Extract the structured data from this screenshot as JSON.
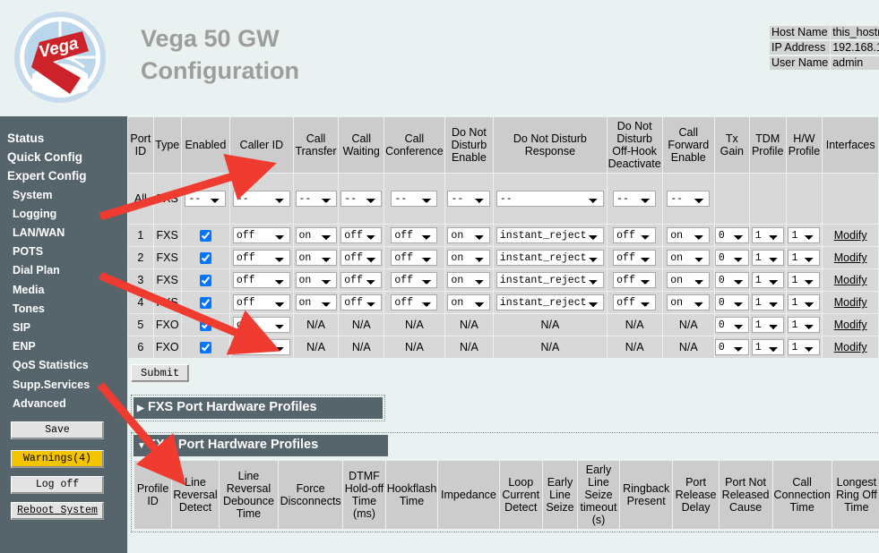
{
  "header": {
    "title_line1": "Vega 50 GW",
    "title_line2": "Configuration",
    "logo_text": "Vega",
    "info": [
      {
        "key": "Host Name",
        "value": "this_hostn"
      },
      {
        "key": "IP Address",
        "value": "192.168.1"
      },
      {
        "key": "User Name",
        "value": "admin"
      }
    ]
  },
  "sidebar": {
    "items": [
      {
        "label": "Status",
        "sub": false
      },
      {
        "label": "Quick Config",
        "sub": false
      },
      {
        "label": "Expert Config",
        "sub": false
      },
      {
        "label": "System",
        "sub": true
      },
      {
        "label": "Logging",
        "sub": true
      },
      {
        "label": "LAN/WAN",
        "sub": true
      },
      {
        "label": "POTS",
        "sub": true
      },
      {
        "label": "Dial Plan",
        "sub": true
      },
      {
        "label": "Media",
        "sub": true
      },
      {
        "label": "Tones",
        "sub": true
      },
      {
        "label": "SIP",
        "sub": true
      },
      {
        "label": "ENP",
        "sub": true
      },
      {
        "label": "QoS Statistics",
        "sub": true
      },
      {
        "label": "Supp.Services",
        "sub": true
      },
      {
        "label": "Advanced",
        "sub": true
      }
    ],
    "save_label": "Save",
    "warnings_label": "Warnings(4)",
    "logoff_label": "Log off",
    "reboot_label": "Reboot System"
  },
  "colors": {
    "sidebar_bg": "#56646b",
    "page_bg": "#eaf1f1",
    "header_cell": "#cccccc",
    "body_cell": "#d8d8d8",
    "warning": "#f5c400",
    "arrow": "#ef3b30",
    "logo_red": "#cc2229",
    "title_grey": "#9d9d9d"
  },
  "ports_table": {
    "columns": [
      "Port ID",
      "Type",
      "Enabled",
      "Caller ID",
      "Call Transfer",
      "Call Waiting",
      "Call Conference",
      "Do Not Disturb Enable",
      "Do Not Disturb Response",
      "Do Not Disturb Off-Hook Deactivate",
      "Call Forward Enable",
      "Tx Gain",
      "TDM Profile",
      "H/W Profile",
      "Interfaces"
    ],
    "all_row": {
      "port_id": "All",
      "type": "FXS",
      "enabled": "--",
      "caller_id": "--",
      "call_transfer": "--",
      "call_waiting": "--",
      "call_conference": "--",
      "dnd_enable": "--",
      "dnd_response": "--",
      "dnd_offhook": "--",
      "call_forward": "--",
      "tx_gain": "",
      "tdm_profile": "",
      "hw_profile": "",
      "interfaces": ""
    },
    "rows": [
      {
        "port_id": "1",
        "type": "FXS",
        "enabled": true,
        "caller_id": "off",
        "call_transfer": "on",
        "call_waiting": "off",
        "call_conference": "off",
        "dnd_enable": "on",
        "dnd_response": "instant_reject",
        "dnd_offhook": "off",
        "call_forward": "on",
        "tx_gain": "0",
        "tdm_profile": "1",
        "hw_profile": "1",
        "interfaces": "Modify"
      },
      {
        "port_id": "2",
        "type": "FXS",
        "enabled": true,
        "caller_id": "off",
        "call_transfer": "on",
        "call_waiting": "off",
        "call_conference": "off",
        "dnd_enable": "on",
        "dnd_response": "instant_reject",
        "dnd_offhook": "off",
        "call_forward": "on",
        "tx_gain": "0",
        "tdm_profile": "1",
        "hw_profile": "1",
        "interfaces": "Modify"
      },
      {
        "port_id": "3",
        "type": "FXS",
        "enabled": true,
        "caller_id": "off",
        "call_transfer": "on",
        "call_waiting": "off",
        "call_conference": "off",
        "dnd_enable": "on",
        "dnd_response": "instant_reject",
        "dnd_offhook": "off",
        "call_forward": "on",
        "tx_gain": "0",
        "tdm_profile": "1",
        "hw_profile": "1",
        "interfaces": "Modify"
      },
      {
        "port_id": "4",
        "type": "FXS",
        "enabled": true,
        "caller_id": "off",
        "call_transfer": "on",
        "call_waiting": "off",
        "call_conference": "off",
        "dnd_enable": "on",
        "dnd_response": "instant_reject",
        "dnd_offhook": "off",
        "call_forward": "on",
        "tx_gain": "0",
        "tdm_profile": "1",
        "hw_profile": "1",
        "interfaces": "Modify"
      },
      {
        "port_id": "5",
        "type": "FXO",
        "enabled": true,
        "caller_id": "on",
        "call_transfer": "N/A",
        "call_waiting": "N/A",
        "call_conference": "N/A",
        "dnd_enable": "N/A",
        "dnd_response": "N/A",
        "dnd_offhook": "N/A",
        "call_forward": "N/A",
        "tx_gain": "0",
        "tdm_profile": "1",
        "hw_profile": "1",
        "interfaces": "Modify"
      },
      {
        "port_id": "6",
        "type": "FXO",
        "enabled": true,
        "caller_id": "on",
        "call_transfer": "N/A",
        "call_waiting": "N/A",
        "call_conference": "N/A",
        "dnd_enable": "N/A",
        "dnd_response": "N/A",
        "dnd_offhook": "N/A",
        "call_forward": "N/A",
        "tx_gain": "0",
        "tdm_profile": "1",
        "hw_profile": "1",
        "interfaces": "Modify"
      }
    ],
    "submit_label": "Submit"
  },
  "sections": {
    "fxs_profiles": {
      "label": "FXS Port Hardware Profiles",
      "expanded": false,
      "triangle": "▶"
    },
    "fxo_profiles": {
      "label": "FXO Port Hardware Profiles",
      "expanded": true,
      "triangle": "▼"
    }
  },
  "fxo_profiles_table": {
    "columns": [
      "Profile ID",
      "Line Reversal Detect",
      "Line Reversal Debounce Time",
      "Force Disconnects",
      "DTMF Hold-off Time (ms)",
      "Hookflash Time",
      "Impedance",
      "Loop Current Detect",
      "Early Line Seize",
      "Early Line Seize timeout (s)",
      "Ringback Present",
      "Port Release Delay",
      "Port Not Released Cause",
      "Call Connection Time",
      "Longest Ring Off Time"
    ]
  }
}
